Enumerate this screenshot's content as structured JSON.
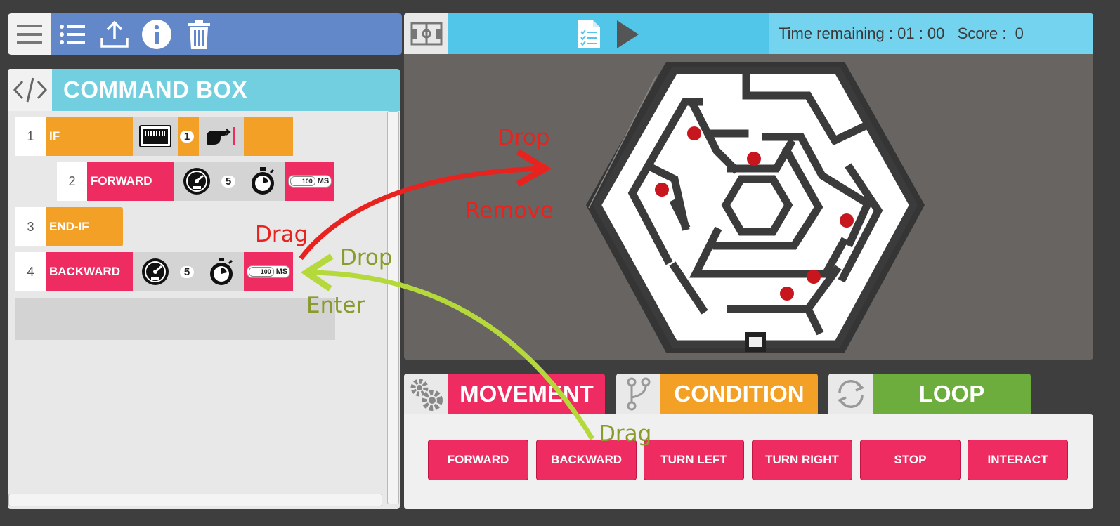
{
  "toolbar": {
    "icons": [
      "menu-icon",
      "list-icon",
      "upload-icon",
      "info-icon",
      "trash-icon"
    ]
  },
  "command_box": {
    "title": "COMMAND BOX",
    "rows": [
      {
        "number": "1",
        "label": "IF",
        "sensor_value": "1"
      },
      {
        "number": "2",
        "label": "FORWARD",
        "speed": "5",
        "duration": "100",
        "unit": "MS"
      },
      {
        "number": "3",
        "label": "END-IF"
      },
      {
        "number": "4",
        "label": "BACKWARD",
        "speed": "5",
        "duration": "100",
        "unit": "MS"
      }
    ]
  },
  "game": {
    "status": "Time remaining : 01 : 00   Score :  0"
  },
  "palette": {
    "tabs": [
      {
        "label": "MOVEMENT",
        "color": "#ee2c62"
      },
      {
        "label": "CONDITION",
        "color": "#f3a126"
      },
      {
        "label": "LOOP",
        "color": "#6cad3e"
      }
    ],
    "buttons": [
      "FORWARD",
      "BACKWARD",
      "TURN LEFT",
      "TURN RIGHT",
      "STOP",
      "INTERACT"
    ]
  },
  "annotations": {
    "red_drop": "Drop",
    "red_remove": "Remove",
    "red_drag": "Drag",
    "green_drop": "Drop",
    "green_enter": "Enter",
    "green_drag": "Drag"
  },
  "colors": {
    "movement": "#ee2c62",
    "condition": "#f3a126",
    "loop": "#6cad3e",
    "toolbar": "#6388c9",
    "command_header": "#72cfdf",
    "game_bar": "#51c6e8",
    "annotation_red": "#e8231f",
    "annotation_green": "#b5d93a"
  }
}
